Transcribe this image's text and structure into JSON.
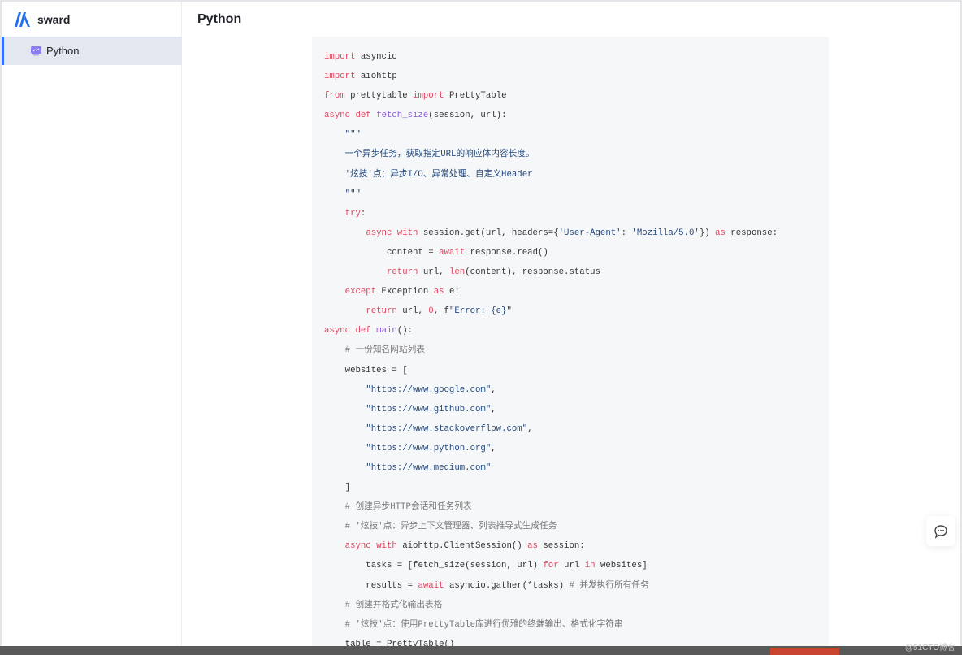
{
  "app": {
    "name": "sward",
    "logo_color": "#1f6ff0"
  },
  "sidebar": {
    "items": [
      {
        "label": "Python",
        "icon": "document-monitor-icon",
        "active": true
      }
    ]
  },
  "header": {
    "title": "Python"
  },
  "code": {
    "lines": [
      [
        [
          "kw",
          "import"
        ],
        [
          "t",
          " asyncio"
        ]
      ],
      [
        [
          "kw",
          "import"
        ],
        [
          "t",
          " aiohttp"
        ]
      ],
      [
        [
          "kw",
          "from"
        ],
        [
          "t",
          " prettytable "
        ],
        [
          "kw",
          "import"
        ],
        [
          "t",
          " PrettyTable"
        ]
      ],
      [
        [
          "kw",
          "async def"
        ],
        [
          "t",
          " "
        ],
        [
          "fn",
          "fetch_size"
        ],
        [
          "t",
          "(session, url):"
        ]
      ],
      [
        [
          "doc",
          "    \"\"\""
        ]
      ],
      [
        [
          "doc",
          "    一个异步任务，获取指定URL的响应体内容长度。"
        ]
      ],
      [
        [
          "doc",
          "    '炫技'点：异步I/O、异常处理、自定义Header"
        ]
      ],
      [
        [
          "doc",
          "    \"\"\""
        ]
      ],
      [
        [
          "t",
          "    "
        ],
        [
          "kw",
          "try"
        ],
        [
          "t",
          ":"
        ]
      ],
      [
        [
          "t",
          "        "
        ],
        [
          "kw",
          "async with"
        ],
        [
          "t",
          " session.get(url, headers={"
        ],
        [
          "str",
          "'User-Agent'"
        ],
        [
          "t",
          ": "
        ],
        [
          "str",
          "'Mozilla/5.0'"
        ],
        [
          "t",
          "}) "
        ],
        [
          "kw",
          "as"
        ],
        [
          "t",
          " response:"
        ]
      ],
      [
        [
          "t",
          "            content = "
        ],
        [
          "kw",
          "await"
        ],
        [
          "t",
          " response.read()"
        ]
      ],
      [
        [
          "t",
          "            "
        ],
        [
          "kw",
          "return"
        ],
        [
          "t",
          " url, "
        ],
        [
          "kw",
          "len"
        ],
        [
          "t",
          "(content), response.status"
        ]
      ],
      [
        [
          "t",
          "    "
        ],
        [
          "kw",
          "except"
        ],
        [
          "t",
          " Exception "
        ],
        [
          "kw",
          "as"
        ],
        [
          "t",
          " e:"
        ]
      ],
      [
        [
          "t",
          "        "
        ],
        [
          "kw",
          "return"
        ],
        [
          "t",
          " url, "
        ],
        [
          "num",
          "0"
        ],
        [
          "t",
          ", f"
        ],
        [
          "str",
          "\"Error: {e}\""
        ]
      ],
      [
        [
          "kw",
          "async def"
        ],
        [
          "t",
          " "
        ],
        [
          "fn",
          "main"
        ],
        [
          "t",
          "():"
        ]
      ],
      [
        [
          "cm",
          "    # 一份知名网站列表"
        ]
      ],
      [
        [
          "t",
          "    websites = ["
        ]
      ],
      [
        [
          "t",
          "        "
        ],
        [
          "str",
          "\"https://www.google.com\""
        ],
        [
          "t",
          ","
        ]
      ],
      [
        [
          "t",
          "        "
        ],
        [
          "str",
          "\"https://www.github.com\""
        ],
        [
          "t",
          ","
        ]
      ],
      [
        [
          "t",
          "        "
        ],
        [
          "str",
          "\"https://www.stackoverflow.com\""
        ],
        [
          "t",
          ","
        ]
      ],
      [
        [
          "t",
          "        "
        ],
        [
          "str",
          "\"https://www.python.org\""
        ],
        [
          "t",
          ","
        ]
      ],
      [
        [
          "t",
          "        "
        ],
        [
          "str",
          "\"https://www.medium.com\""
        ]
      ],
      [
        [
          "t",
          "    ]"
        ]
      ],
      [
        [
          "cm",
          "    # 创建异步HTTP会话和任务列表"
        ]
      ],
      [
        [
          "cm",
          "    # '炫技'点：异步上下文管理器、列表推导式生成任务"
        ]
      ],
      [
        [
          "t",
          "    "
        ],
        [
          "kw",
          "async with"
        ],
        [
          "t",
          " aiohttp.ClientSession() "
        ],
        [
          "kw",
          "as"
        ],
        [
          "t",
          " session:"
        ]
      ],
      [
        [
          "t",
          "        tasks = [fetch_size(session, url) "
        ],
        [
          "kw",
          "for"
        ],
        [
          "t",
          " url "
        ],
        [
          "kw",
          "in"
        ],
        [
          "t",
          " websites]"
        ]
      ],
      [
        [
          "t",
          "        results = "
        ],
        [
          "kw",
          "await"
        ],
        [
          "t",
          " asyncio.gather(*tasks) "
        ],
        [
          "cm",
          "# 并发执行所有任务"
        ]
      ],
      [
        [
          "cm",
          "    # 创建并格式化输出表格"
        ]
      ],
      [
        [
          "cm",
          "    # '炫技'点：使用PrettyTable库进行优雅的终端输出、格式化字符串"
        ]
      ],
      [
        [
          "t",
          "    table = PrettyTable()"
        ]
      ]
    ]
  },
  "watermark": "@51CTO博客"
}
